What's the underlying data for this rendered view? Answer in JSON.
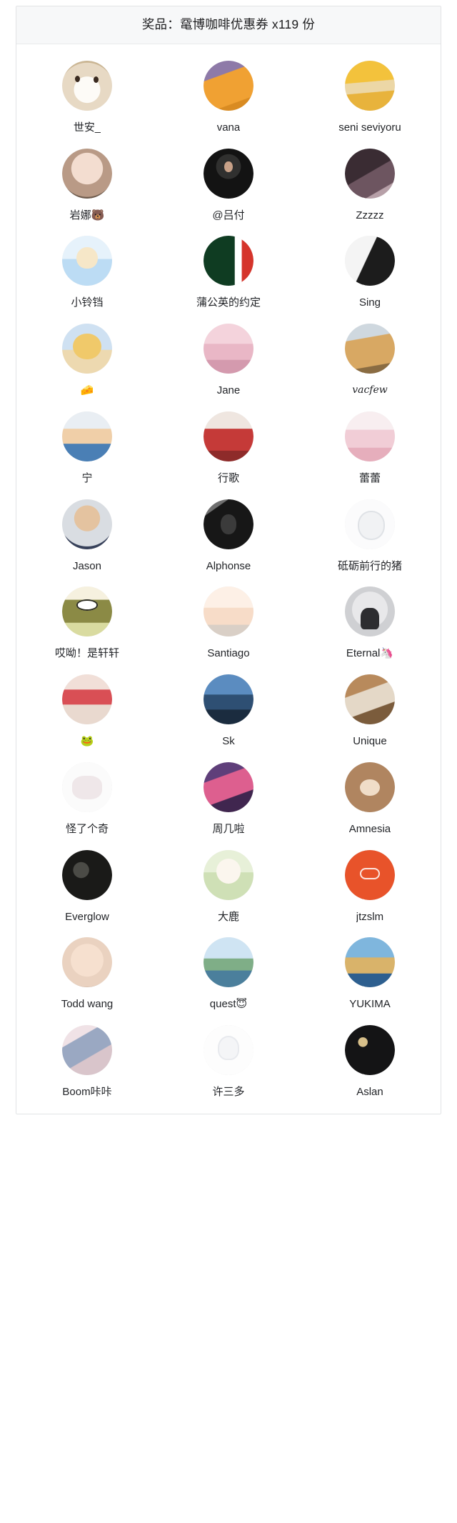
{
  "header": {
    "prize_label": "奖品：",
    "prize_name": "鼋博咖啡优惠券",
    "quantity": "x119 份",
    "full_title": "奖品：鼋博咖啡优惠券 x119 份"
  },
  "winners": [
    {
      "name": "世安_",
      "avatar": "a-cat"
    },
    {
      "name": "vana",
      "avatar": "a-girl-orange"
    },
    {
      "name": "seni seviyoru",
      "avatar": "a-girl-yellow"
    },
    {
      "name": "岩娜🐻",
      "avatar": "a-baby"
    },
    {
      "name": "@吕付",
      "avatar": "a-dark-man"
    },
    {
      "name": "Zzzzz",
      "avatar": "a-darkhair"
    },
    {
      "name": "小铃铛",
      "avatar": "a-blue-cat"
    },
    {
      "name": "蒲公英的约定",
      "avatar": "a-green"
    },
    {
      "name": "Sing",
      "avatar": "a-bw"
    },
    {
      "name": "🧀",
      "avatar": "a-toy"
    },
    {
      "name": "Jane",
      "avatar": "a-pinkgirl"
    },
    {
      "name": "vacfew",
      "avatar": "a-dog",
      "style": "script"
    },
    {
      "name": "宁",
      "avatar": "a-boy"
    },
    {
      "name": "行歌",
      "avatar": "a-redgirl"
    },
    {
      "name": "蕾蕾",
      "avatar": "a-softgirl"
    },
    {
      "name": "Jason",
      "avatar": "a-trump"
    },
    {
      "name": "Alphonse",
      "avatar": "a-mono"
    },
    {
      "name": "砥砺前行的猪",
      "avatar": "a-whitedog"
    },
    {
      "name": "哎呦！是轩轩",
      "avatar": "a-frog"
    },
    {
      "name": "Santiago",
      "avatar": "a-anime"
    },
    {
      "name": "Eternal🦄",
      "avatar": "a-grey"
    },
    {
      "name": "🐸",
      "avatar": "a-jk"
    },
    {
      "name": "Sk",
      "avatar": "a-sea"
    },
    {
      "name": "Unique",
      "avatar": "a-mag"
    },
    {
      "name": "怪了个奇",
      "avatar": "a-sketch"
    },
    {
      "name": "周几啦",
      "avatar": "a-kpop"
    },
    {
      "name": "Amnesia",
      "avatar": "a-bear"
    },
    {
      "name": "Everglow",
      "avatar": "a-night"
    },
    {
      "name": "大鹿",
      "avatar": "a-rabbit"
    },
    {
      "name": "jtzslm",
      "avatar": "a-orange"
    },
    {
      "name": "Todd wang",
      "avatar": "a-kid"
    },
    {
      "name": "quest😇",
      "avatar": "a-lake"
    },
    {
      "name": "YUKIMA",
      "avatar": "a-temple"
    },
    {
      "name": "Boom咔咔",
      "avatar": "a-pics"
    },
    {
      "name": "许三多",
      "avatar": "a-bunny"
    },
    {
      "name": "Aslan",
      "avatar": "a-spark"
    }
  ]
}
